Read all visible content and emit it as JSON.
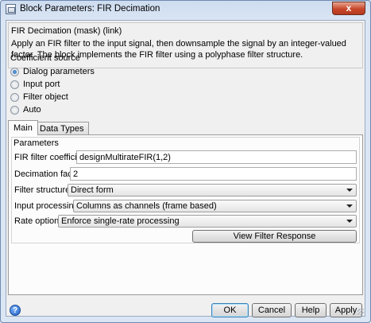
{
  "window": {
    "title": "Block Parameters: FIR Decimation",
    "close_glyph": "x"
  },
  "description": {
    "title": "FIR Decimation (mask) (link)",
    "text": "Apply an FIR filter to the input signal, then downsample the signal by an integer-valued factor. The block implements the FIR filter using a polyphase filter structure."
  },
  "coefficient_source": {
    "label": "Coefficient source",
    "options": [
      {
        "label": "Dialog parameters",
        "selected": true
      },
      {
        "label": "Input port",
        "selected": false
      },
      {
        "label": "Filter object",
        "selected": false
      },
      {
        "label": "Auto",
        "selected": false
      }
    ]
  },
  "tabs": [
    {
      "label": "Main",
      "active": true
    },
    {
      "label": "Data Types",
      "active": false
    }
  ],
  "parameters": {
    "title": "Parameters",
    "fir_coeffs": {
      "label": "FIR filter coefficients:",
      "value": "designMultirateFIR(1,2)"
    },
    "decimation": {
      "label": "Decimation factor:",
      "value": "2"
    },
    "filter_structure": {
      "label": "Filter structure:",
      "value": "Direct form"
    },
    "input_processing": {
      "label": "Input processing:",
      "value": "Columns as channels (frame based)"
    },
    "rate_options": {
      "label": "Rate options:",
      "value": "Enforce single-rate processing"
    },
    "view_response_label": "View Filter Response"
  },
  "footer": {
    "help_glyph": "?",
    "ok": "OK",
    "cancel": "Cancel",
    "help": "Help",
    "apply": "Apply"
  }
}
